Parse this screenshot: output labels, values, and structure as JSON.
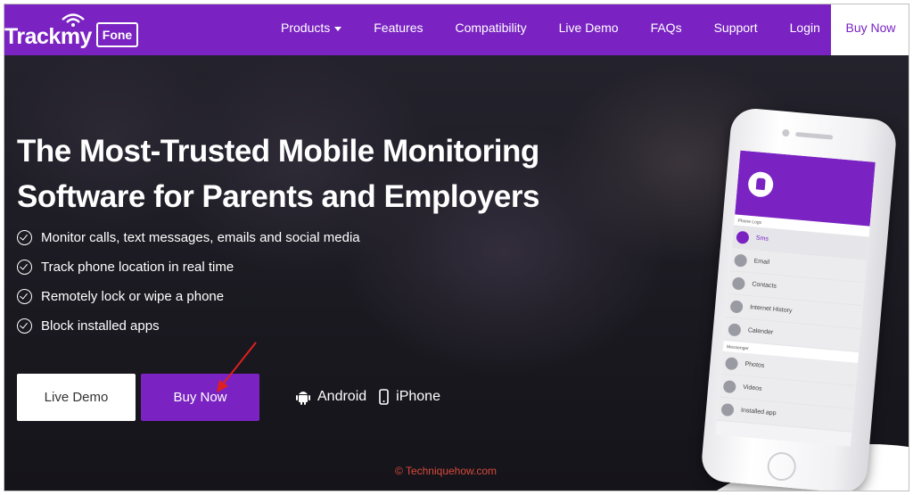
{
  "brand": {
    "name": "Trackmy",
    "badge": "Fone"
  },
  "nav": {
    "items": [
      {
        "label": "Products"
      },
      {
        "label": "Features"
      },
      {
        "label": "Compatibility"
      },
      {
        "label": "Live Demo"
      },
      {
        "label": "FAQs"
      },
      {
        "label": "Support"
      },
      {
        "label": "Login"
      }
    ],
    "buy_label": "Buy Now"
  },
  "hero": {
    "headline_line1": "The Most-Trusted Mobile Monitoring",
    "headline_line2": "Software for Parents and Employers",
    "features": [
      "Monitor calls, text messages, emails and social media",
      "Track phone location in real time",
      "Remotely lock or wipe a phone",
      "Block installed apps"
    ],
    "demo_button": "Live Demo",
    "buy_button": "Buy Now",
    "platforms": [
      "Android",
      "iPhone"
    ]
  },
  "phone_screen": {
    "section1": "Phone Logs",
    "rows1": [
      "Sms",
      "Email",
      "Contacts",
      "Internet History",
      "Calender"
    ],
    "section2": "Messenger",
    "rows2": [
      "Photos",
      "Videos",
      "Installed app"
    ]
  },
  "watermark": "© Techniquehow.com",
  "colors": {
    "brand": "#7a23c2",
    "annotation_arrow": "#e02020"
  }
}
